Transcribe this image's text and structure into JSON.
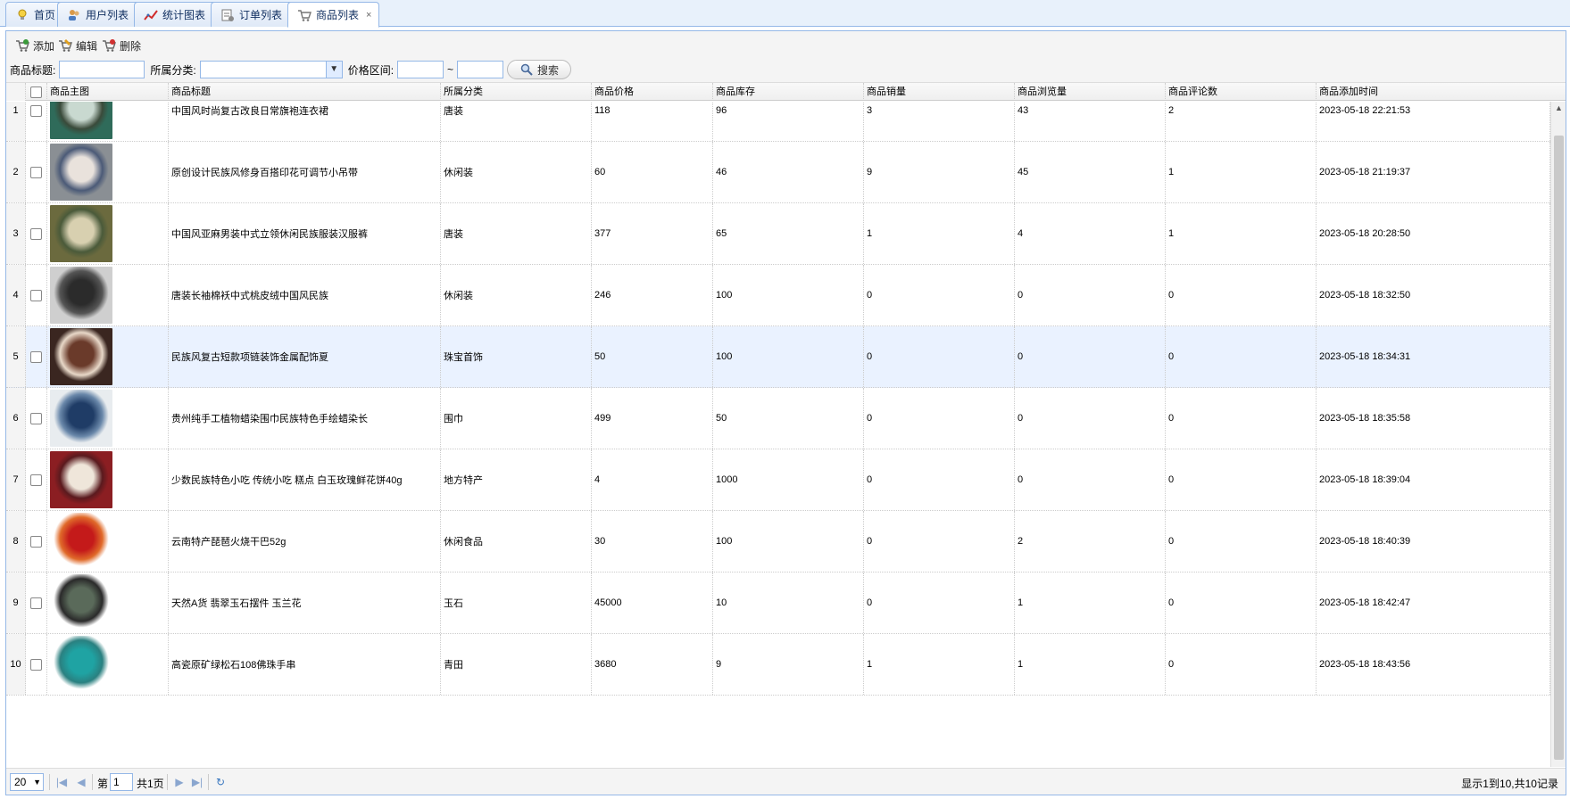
{
  "tabs": [
    {
      "label": "首页",
      "icon": "bulb-icon",
      "closable": false
    },
    {
      "label": "用户列表",
      "icon": "users-icon",
      "closable": true
    },
    {
      "label": "统计图表",
      "icon": "chart-icon",
      "closable": true
    },
    {
      "label": "订单列表",
      "icon": "order-icon",
      "closable": true
    },
    {
      "label": "商品列表",
      "icon": "cart-icon",
      "closable": true,
      "active": true
    }
  ],
  "toolbar": {
    "add": "添加",
    "edit": "编辑",
    "delete": "删除"
  },
  "search": {
    "title_label": "商品标题:",
    "title_value": "",
    "category_label": "所属分类:",
    "category_value": "",
    "price_label": "价格区间:",
    "price_min": "",
    "range_sep": "~",
    "price_max": "",
    "search_button": "搜索"
  },
  "grid": {
    "columns": [
      "商品主图",
      "商品标题",
      "所属分类",
      "商品价格",
      "商品库存",
      "商品销量",
      "商品浏览量",
      "商品评论数",
      "商品添加时间"
    ],
    "rows": [
      {
        "no": "1",
        "title": "中国风时尚复古改良日常旗袍连衣裙",
        "category": "唐装",
        "price": "118",
        "stock": "96",
        "sales": "3",
        "views": "43",
        "comments": "2",
        "time": "2023-05-18 22:21:53",
        "img": [
          "#2f6b5a",
          "#c9d9d0",
          "#3a4a3a"
        ]
      },
      {
        "no": "2",
        "title": "原创设计民族风修身百搭印花可调节小吊带",
        "category": "休闲装",
        "price": "60",
        "stock": "46",
        "sales": "9",
        "views": "45",
        "comments": "1",
        "time": "2023-05-18 21:19:37",
        "img": [
          "#8a8f94",
          "#e9e2dc",
          "#4b5a77"
        ]
      },
      {
        "no": "3",
        "title": "中国风亚麻男装中式立领休闲民族服装汉服裤",
        "category": "唐装",
        "price": "377",
        "stock": "65",
        "sales": "1",
        "views": "4",
        "comments": "1",
        "time": "2023-05-18 20:28:50",
        "img": [
          "#6b6a3e",
          "#d8d0b0",
          "#4a5a3a"
        ]
      },
      {
        "no": "4",
        "title": "唐装长袖棉袄中式桃皮绒中国风民族",
        "category": "休闲装",
        "price": "246",
        "stock": "100",
        "sales": "0",
        "views": "0",
        "comments": "0",
        "time": "2023-05-18 18:32:50",
        "img": [
          "#cfcfcf",
          "#2b2b2b",
          "#555555"
        ]
      },
      {
        "no": "5",
        "title": "民族风复古短款项链装饰金属配饰夏",
        "category": "珠宝首饰",
        "price": "50",
        "stock": "100",
        "sales": "0",
        "views": "0",
        "comments": "0",
        "time": "2023-05-18 18:34:31",
        "img": [
          "#3a2620",
          "#6a3a2a",
          "#e8d8c8"
        ],
        "selected": true
      },
      {
        "no": "6",
        "title": "贵州纯手工植物蜡染围巾民族特色手绘蜡染长",
        "category": "围巾",
        "price": "499",
        "stock": "50",
        "sales": "0",
        "views": "0",
        "comments": "0",
        "time": "2023-05-18 18:35:58",
        "img": [
          "#e8ecef",
          "#1f3c66",
          "#6a88aa"
        ]
      },
      {
        "no": "7",
        "title": "少数民族特色小吃 传统小吃 糕点 白玉玫瑰鲜花饼40g",
        "category": "地方特产",
        "price": "4",
        "stock": "1000",
        "sales": "0",
        "views": "0",
        "comments": "0",
        "time": "2023-05-18 18:39:04",
        "img": [
          "#8b1e22",
          "#efe6da",
          "#5a1a1e"
        ]
      },
      {
        "no": "8",
        "title": "云南特产琵琶火烧干巴52g",
        "category": "休闲食品",
        "price": "30",
        "stock": "100",
        "sales": "0",
        "views": "2",
        "comments": "0",
        "time": "2023-05-18 18:40:39",
        "img": [
          "#ffffff",
          "#c41a1a",
          "#e06a2a"
        ]
      },
      {
        "no": "9",
        "title": "天然A货 翡翠玉石摆件 玉兰花",
        "category": "玉石",
        "price": "45000",
        "stock": "10",
        "sales": "0",
        "views": "1",
        "comments": "0",
        "time": "2023-05-18 18:42:47",
        "img": [
          "#ffffff",
          "#5a6a5a",
          "#2a2a2a"
        ]
      },
      {
        "no": "10",
        "title": "高瓷原矿绿松石108佛珠手串",
        "category": "青田",
        "price": "3680",
        "stock": "9",
        "sales": "1",
        "views": "1",
        "comments": "0",
        "time": "2023-05-18 18:43:56",
        "img": [
          "#ffffff",
          "#1fa3a3",
          "#2a8080"
        ]
      }
    ]
  },
  "pager": {
    "page_size": "20",
    "page_prefix": "第",
    "page_value": "1",
    "page_total": "共1页",
    "info": "显示1到10,共10记录"
  },
  "colors": {
    "accent_border": "#95b8e7",
    "selected_row": "#eaf2ff",
    "tab_bg": "#e8f1fb"
  }
}
